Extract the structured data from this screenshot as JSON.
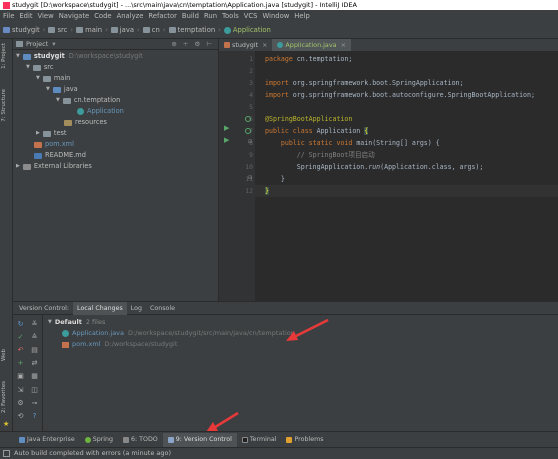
{
  "window": {
    "title": "studygit [D:\\workspace\\studygit] - ...\\src\\main\\java\\cn\\temptation\\Application.java [studygit] - IntelliJ IDEA"
  },
  "menu": [
    "File",
    "Edit",
    "View",
    "Navigate",
    "Code",
    "Analyze",
    "Refactor",
    "Build",
    "Run",
    "Tools",
    "VCS",
    "Window",
    "Help"
  ],
  "breadcrumbs": [
    "studygit",
    "src",
    "main",
    "java",
    "cn",
    "temptation",
    "Application"
  ],
  "left_strip": {
    "project": "1: Project",
    "structure": "7: Structure",
    "web": "Web",
    "favorites": "2: Favorites"
  },
  "project_panel": {
    "title": "Project",
    "tools": "⊕ ÷ ⚙ ⊢",
    "tree": [
      {
        "label": "studygit",
        "path": "D:\\workspace\\studygit"
      },
      {
        "label": "src"
      },
      {
        "label": "main"
      },
      {
        "label": "java"
      },
      {
        "label": "cn.temptation"
      },
      {
        "label": "Application"
      },
      {
        "label": "resources"
      },
      {
        "label": "test"
      },
      {
        "label": "pom.xml"
      },
      {
        "label": "README.md"
      },
      {
        "label": "External Libraries"
      }
    ]
  },
  "editor_tabs": [
    {
      "label": "studygit",
      "close": "×"
    },
    {
      "label": "Application.java",
      "close": "×"
    }
  ],
  "editor": {
    "line_numbers": [
      "1",
      "2",
      "3",
      "4",
      "5",
      "6",
      "7",
      "8",
      "9",
      "10",
      "11",
      "12"
    ],
    "code": {
      "l1_kw": "package",
      "l1_rest": " cn.temptation;",
      "l3_kw": "import",
      "l3_rest": " org.springframework.boot.SpringApplication;",
      "l4_kw": "import",
      "l4_rest": " org.springframework.boot.autoconfigure.SpringBootApplication;",
      "l6_ann": "@SpringBootApplication",
      "l7_kw": "public class",
      "l7_rest": " Application ",
      "l7_brace": "{",
      "l8_kw": "    public static void",
      "l8_rest": " main(String[] args) {",
      "l9_cm": "        // SpringBoot项目启动",
      "l10_a": "        SpringApplication.",
      "l10_it": "run",
      "l10_b": "(Application.class, args);",
      "l11": "    }",
      "l12": "}"
    }
  },
  "bottom_tabs": [
    "Version Control:",
    "Local Changes",
    "Log",
    "Console"
  ],
  "version_control": {
    "group": "Default",
    "count": "2 files",
    "files": [
      {
        "name": "Application.java",
        "path": "D:/workspace/studygit/src/main/java/cn/temptation"
      },
      {
        "name": "pom.xml",
        "path": "D:/workspace/studygit"
      }
    ]
  },
  "tool_windows": [
    "Java Enterprise",
    "Spring",
    "6: TODO",
    "9: Version Control",
    "Terminal",
    "Problems"
  ],
  "status": "Auto build completed with errors (a minute ago)",
  "colors": {
    "accent_green": "#a3c46b",
    "changed_blue": "#6897bb",
    "arrow_red": "#e63a3a"
  }
}
